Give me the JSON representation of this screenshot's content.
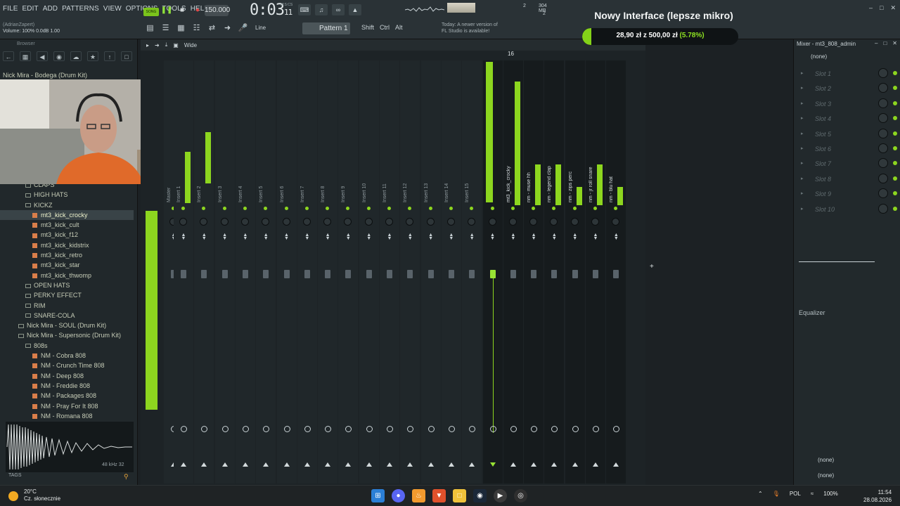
{
  "menu": [
    "FILE",
    "EDIT",
    "ADD",
    "PATTERNS",
    "VIEW",
    "OPTIONS",
    "TOOLS",
    "HELP"
  ],
  "transport": {
    "song_label": "SONG",
    "tempo": "150.000",
    "time_main": "0:03",
    "time_small": "11",
    "time_unit": "M:S:CS"
  },
  "cpu": {
    "memory": "304 MB",
    "poly": "2",
    "voices": "2"
  },
  "hint": {
    "user": "(AdrianZapert)",
    "volume": "Volume: 100% 0.0dB",
    "value": "1.00"
  },
  "toolbar2": {
    "snap": "Line",
    "pattern": "Pattern 1",
    "mods": [
      "Shift",
      "Ctrl",
      "Alt"
    ]
  },
  "news": {
    "line1": "Today: A newer version of",
    "line2": "FL Studio is available!"
  },
  "browser": {
    "title": "Browser",
    "tree": [
      {
        "label": "CLAPS",
        "type": "folder",
        "indent": 2
      },
      {
        "label": "HIGH HATS",
        "type": "folder",
        "indent": 2
      },
      {
        "label": "KICKZ",
        "type": "folder",
        "indent": 2
      },
      {
        "label": "mt3_kick_crocky",
        "type": "file",
        "indent": 3,
        "selected": true
      },
      {
        "label": "mt3_kick_cult",
        "type": "file",
        "indent": 3
      },
      {
        "label": "mt3_kick_f12",
        "type": "file",
        "indent": 3
      },
      {
        "label": "mt3_kick_kidstrix",
        "type": "file",
        "indent": 3
      },
      {
        "label": "mt3_kick_retro",
        "type": "file",
        "indent": 3
      },
      {
        "label": "mt3_kick_star",
        "type": "file",
        "indent": 3
      },
      {
        "label": "mt3_kick_thwomp",
        "type": "file",
        "indent": 3
      },
      {
        "label": "OPEN HATS",
        "type": "folder",
        "indent": 2
      },
      {
        "label": "PERKY EFFECT",
        "type": "folder",
        "indent": 2
      },
      {
        "label": "RIM",
        "type": "folder",
        "indent": 2
      },
      {
        "label": "SNARE-COLA",
        "type": "folder",
        "indent": 2
      },
      {
        "label": "Nick Mira - SOUL (Drum Kit)",
        "type": "folder",
        "indent": 1
      },
      {
        "label": "Nick Mira - Supersonic (Drum Kit)",
        "type": "folder",
        "indent": 1
      },
      {
        "label": "808s",
        "type": "folder",
        "indent": 2
      },
      {
        "label": "NM - Cobra 808",
        "type": "file",
        "indent": 3
      },
      {
        "label": "NM - Crunch Time 808",
        "type": "file",
        "indent": 3
      },
      {
        "label": "NM - Deep 808",
        "type": "file",
        "indent": 3
      },
      {
        "label": "NM - Freddie 808",
        "type": "file",
        "indent": 3
      },
      {
        "label": "NM - Packages 808",
        "type": "file",
        "indent": 3
      },
      {
        "label": "NM - Pray For It 808",
        "type": "file",
        "indent": 3
      },
      {
        "label": "NM - Romana 808",
        "type": "file",
        "indent": 3
      }
    ],
    "top_items": [
      "Nick Mira - Bodega (Drum Kit)"
    ],
    "wave_meta": "48 kHz 32",
    "tags_label": "TAGS"
  },
  "mixer": {
    "view_label": "Wide",
    "selected_channel": "16",
    "channels": [
      "Master",
      "Insert 1",
      "Insert 2",
      "Insert 3",
      "Insert 4",
      "Insert 5",
      "Insert 6",
      "Insert 7",
      "Insert 8",
      "Insert 9",
      "Insert 10",
      "Insert 11",
      "Insert 12",
      "Insert 13",
      "Insert 14",
      "Insert 15",
      "mt3_808_admin",
      "mt3_kick_crocky",
      "nm - muse hh",
      "nm - legend clap",
      "nm - zips perc",
      "nm - jr roll snare",
      "nm - blu hat"
    ]
  },
  "overlay": {
    "title": "Nowy Interface (lepsze mikro)",
    "amount": "28,90 zł",
    "of": "z",
    "goal": "500,00 zł",
    "percent": "(5.78%)",
    "progress": 0.0578
  },
  "right_panel": {
    "title": "Mixer - mt3_808_admin",
    "preset": "(none)",
    "slots": [
      "Slot 1",
      "Slot 2",
      "Slot 3",
      "Slot 4",
      "Slot 5",
      "Slot 6",
      "Slot 7",
      "Slot 8",
      "Slot 9",
      "Slot 10"
    ],
    "eq_label": "Equalizer",
    "bottom1": "(none)",
    "bottom2": "(none)"
  },
  "taskbar": {
    "temp": "20°C",
    "weather": "Cz. słonecznie",
    "lang": "POL",
    "battery": "100%",
    "time": "11:54",
    "date": "28.08.2026"
  },
  "colors": {
    "accent": "#8dd61f",
    "bg": "#1d2326",
    "rec": "#e04747"
  }
}
